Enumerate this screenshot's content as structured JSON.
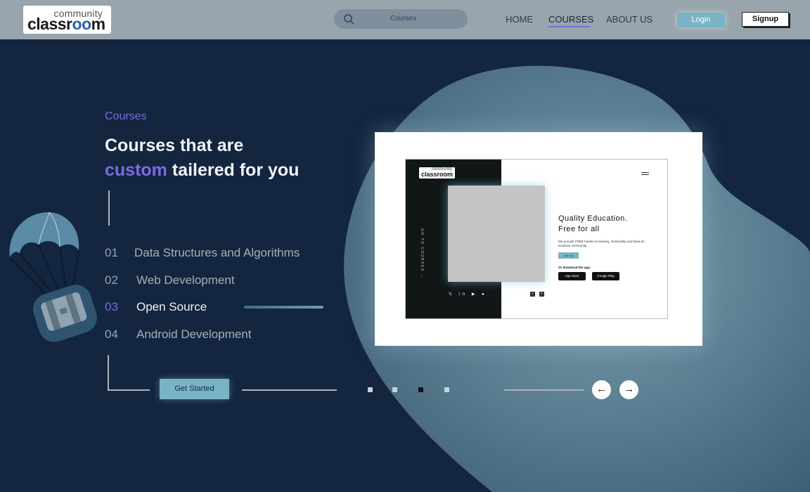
{
  "nav": {
    "logo_top": "community",
    "logo_bottom_start": "classr",
    "logo_bottom_oo": "oo",
    "logo_bottom_end": "m",
    "search_value": "Courses",
    "links": [
      "HOME",
      "COURSES",
      "ABOUT US"
    ],
    "active_link": "COURSES",
    "login_label": "Login",
    "signup_label": "Signup"
  },
  "hero": {
    "eyebrow": "Courses",
    "headline_line1": "Courses that are",
    "headline_accent": "custom",
    "headline_rest": "tailered for you",
    "courses": [
      {
        "num": "01",
        "name": "Data Structures and Algorithms"
      },
      {
        "num": "02",
        "name": "Web Development"
      },
      {
        "num": "03",
        "name": "Open Source",
        "active": true
      },
      {
        "num": "04",
        "name": "Android Development"
      }
    ],
    "cta_label": "Get Started",
    "carousel_active_index": 2,
    "carousel_count": 4,
    "prev_arrow": "←",
    "next_arrow": "→"
  },
  "preview": {
    "logo_top": "community",
    "logo_bottom": "classroom",
    "vertical_text": "GO TO COURSES →",
    "title_line1": "Quality Education.",
    "title_line2": "Free for all",
    "subtitle": "We provide FREE hands-on training, mentorship and have an inclusive community.",
    "join_label": "Join us",
    "download_label": "Or download the app:",
    "app_store": "App Store",
    "google_play": "Google Play",
    "social_icons": "twitter-icon linkedin-icon youtube-icon discord-icon",
    "mini_prev": "‹",
    "mini_next": "›"
  },
  "colors": {
    "background": "#13253f",
    "navbar": "#99a5ad",
    "accent_purple": "#7a6be0",
    "accent_teal": "#79b3c6",
    "blob": "#5d8599"
  }
}
